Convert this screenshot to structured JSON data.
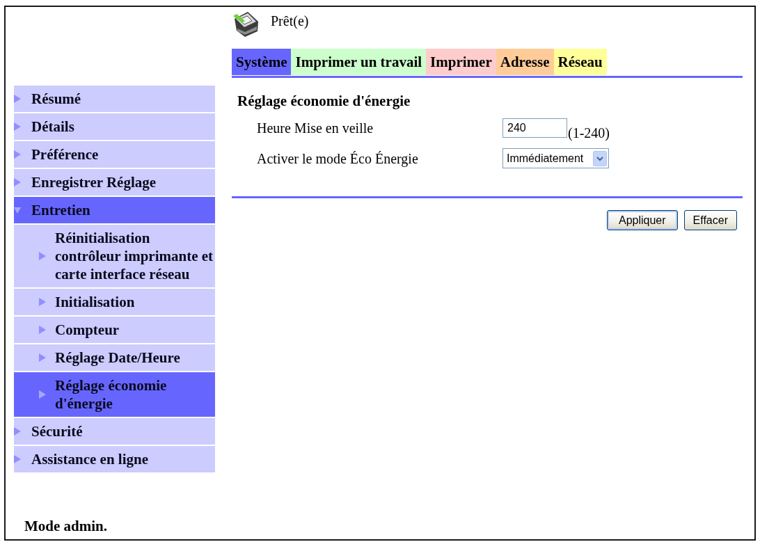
{
  "header": {
    "status": "Prêt(e)"
  },
  "tabs": [
    {
      "label": "Système",
      "color": "#6666ff"
    },
    {
      "label": "Imprimer un travail",
      "color": "#ccffcc"
    },
    {
      "label": "Imprimer",
      "color": "#ffcccc"
    },
    {
      "label": "Adresse",
      "color": "#ffcc99"
    },
    {
      "label": "Réseau",
      "color": "#ffff99"
    }
  ],
  "sidebar": {
    "items": [
      {
        "label": "Résumé",
        "selected": false,
        "expanded": false
      },
      {
        "label": "Détails",
        "selected": false,
        "expanded": false
      },
      {
        "label": "Préférence",
        "selected": false,
        "expanded": false
      },
      {
        "label": "Enregistrer Réglage",
        "selected": false,
        "expanded": false
      },
      {
        "label": "Entretien",
        "selected": true,
        "expanded": true,
        "children": [
          {
            "label": "Réinitialisation contrôleur imprimante et carte interface réseau",
            "selected": false
          },
          {
            "label": "Initialisation",
            "selected": false
          },
          {
            "label": "Compteur",
            "selected": false
          },
          {
            "label": "Réglage Date/Heure",
            "selected": false
          },
          {
            "label": "Réglage économie d'énergie",
            "selected": true
          }
        ]
      },
      {
        "label": "Sécurité",
        "selected": false,
        "expanded": false
      },
      {
        "label": "Assistance en ligne",
        "selected": false,
        "expanded": false
      }
    ]
  },
  "form": {
    "title": "Réglage économie d'énergie",
    "fields": [
      {
        "kind": "text",
        "label": "Heure Mise en veille",
        "value": "240",
        "note": "(1-240)"
      },
      {
        "kind": "select",
        "label": "Activer le mode Éco Énergie",
        "value": "Immédiatement"
      }
    ]
  },
  "buttons": [
    {
      "label": "Appliquer",
      "default": true
    },
    {
      "label": "Effacer",
      "default": false
    }
  ],
  "footer": {
    "mode": "Mode admin."
  }
}
